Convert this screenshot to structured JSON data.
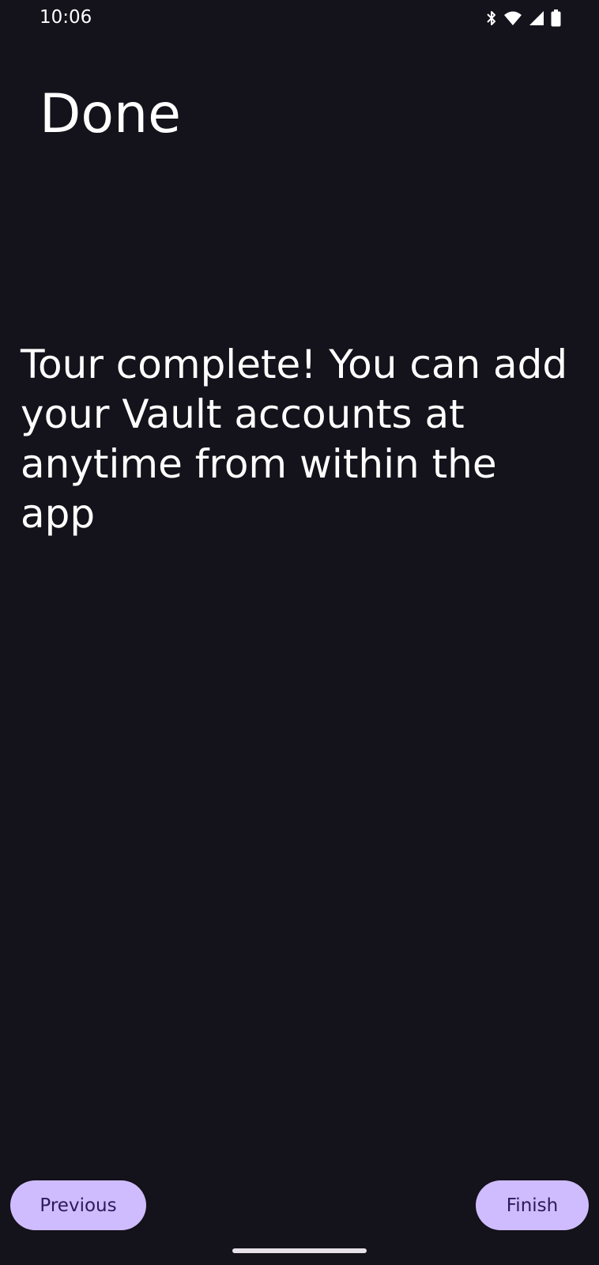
{
  "status_bar": {
    "time": "10:06",
    "icons": [
      "bluetooth-icon",
      "wifi-icon",
      "cell-signal-icon",
      "battery-icon"
    ]
  },
  "page": {
    "title": "Done",
    "message": "Tour complete! You can add your Vault accounts at anytime from within the app"
  },
  "buttons": {
    "previous_label": "Previous",
    "finish_label": "Finish"
  },
  "colors": {
    "background": "#14121a",
    "button_background": "#cfbcff",
    "button_text": "#2b1b5a",
    "text": "#ffffff"
  }
}
